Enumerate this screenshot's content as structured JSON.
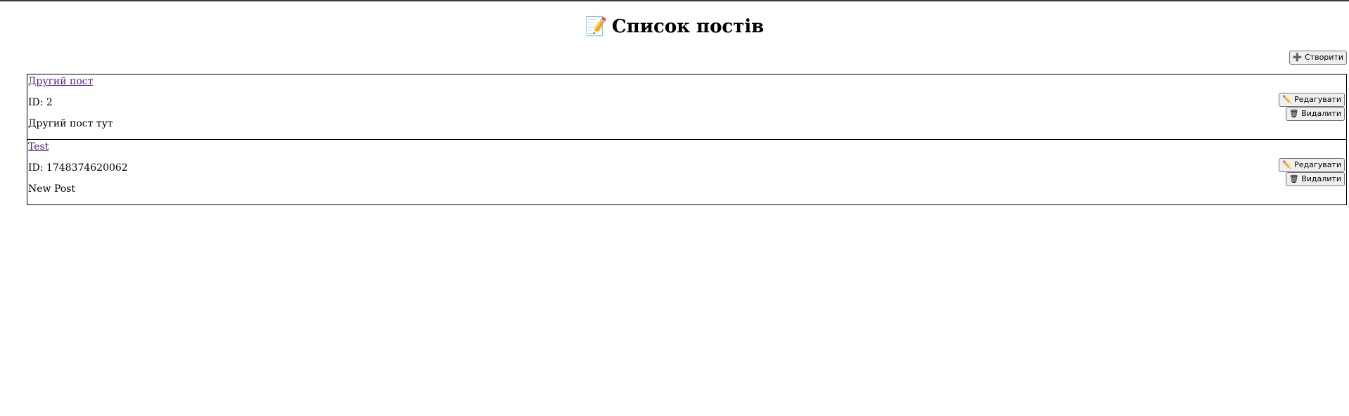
{
  "page": {
    "title_icon": "📝",
    "title": "Список постів"
  },
  "toolbar": {
    "create_label": "➕ Створити"
  },
  "posts": [
    {
      "title": "Другий пост",
      "id_text": "ID: 2",
      "body": "Другий пост тут",
      "edit_label": "✏️ Редагувати",
      "delete_label": "🗑 Видалити"
    },
    {
      "title": "Test",
      "id_text": "ID: 1748374620062",
      "body": "New Post",
      "edit_label": "✏️ Редагувати",
      "delete_label": "🗑 Видалити"
    }
  ],
  "colors": {
    "link_visited": "#551a8b",
    "border": "#000000",
    "button_bg": "#efefef"
  }
}
